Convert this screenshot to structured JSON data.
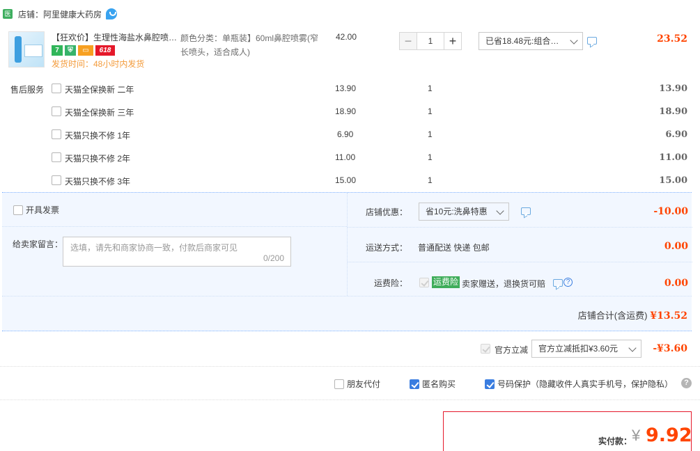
{
  "shop": {
    "badge": "医",
    "label": "店铺：阿里健康大药房"
  },
  "item": {
    "title": "【狂欢价】生理性海盐水鼻腔喷…",
    "badges": {
      "seven": "7",
      "sale": "618"
    },
    "delivery": "发货时间：48小时内发货",
    "sku": "颜色分类：单瓶装】60ml鼻腔喷雾(窄长喷头，适合成人)",
    "unit_price": "42.00",
    "qty_minus": "−",
    "qty_value": "1",
    "qty_plus": "+",
    "discount_select": "已省18.48元:组合…",
    "subtotal": "23.52"
  },
  "after_sales": {
    "label": "售后服务",
    "items": [
      {
        "name": "天猫全保换新 二年",
        "price": "13.90",
        "qty": "1",
        "subtotal": "13.90"
      },
      {
        "name": "天猫全保换新 三年",
        "price": "18.90",
        "qty": "1",
        "subtotal": "18.90"
      },
      {
        "name": "天猫只换不修 1年",
        "price": "6.90",
        "qty": "1",
        "subtotal": "6.90"
      },
      {
        "name": "天猫只换不修 2年",
        "price": "11.00",
        "qty": "1",
        "subtotal": "11.00"
      },
      {
        "name": "天猫只换不修 3年",
        "price": "15.00",
        "qty": "1",
        "subtotal": "15.00"
      }
    ]
  },
  "order": {
    "invoice_label": "开具发票",
    "memo_label": "给卖家留言：",
    "memo_placeholder": "选填，请先和商家协商一致，付款后商家可见",
    "memo_count": "0/200",
    "shop_discount_label": "店铺优惠：",
    "shop_discount_select": "省10元:洗鼻特惠",
    "shop_discount_value": "-10.00",
    "shipping_label": "运送方式：",
    "shipping_method": "普通配送 快递 包邮",
    "shipping_value": "0.00",
    "insurance_label": "运费险：",
    "insurance_tag": "运费险",
    "insurance_desc": "卖家赠送，退换货可赔",
    "insurance_value": "0.00",
    "shop_total_label": "店铺合计(含运费)",
    "shop_total_value": "¥13.52"
  },
  "official": {
    "label": "官方立减",
    "select": "官方立减抵扣¥3.60元",
    "value": "-¥3.60"
  },
  "options": {
    "friend_pay": "朋友代付",
    "anonymous": "匿名购买",
    "privacy": "号码保护（隐藏收件人真实手机号，保护隐私）",
    "help": "?"
  },
  "payment": {
    "label": "实付款：",
    "currency": "¥",
    "amount": "9.92"
  },
  "colors": {
    "price_red": "#ff4400",
    "panel_bg": "#f2f7ff",
    "check_blue": "#3a7de0",
    "pay_border": "#e5182a"
  }
}
